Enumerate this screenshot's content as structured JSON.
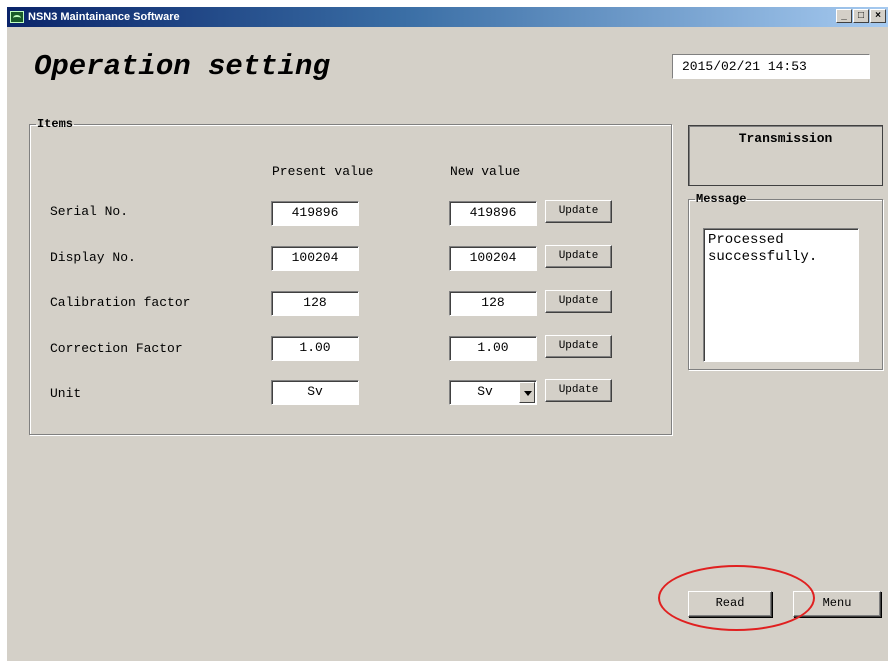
{
  "window": {
    "title": "NSN3 Maintainance Software",
    "minimize": "_",
    "maximize": "□",
    "close": "×"
  },
  "page": {
    "heading": "Operation setting",
    "datetime": "2015/02/21 14:53"
  },
  "items": {
    "legend": "Items",
    "present_header": "Present value",
    "new_header": "New value",
    "rows": [
      {
        "label": "Serial No.",
        "present": "419896",
        "new": "419896",
        "button": "Update"
      },
      {
        "label": "Display No.",
        "present": "100204",
        "new": "100204",
        "button": "Update"
      },
      {
        "label": "Calibration factor",
        "present": "128",
        "new": "128",
        "button": "Update"
      },
      {
        "label": "Correction Factor",
        "present": "1.00",
        "new": "1.00",
        "button": "Update"
      },
      {
        "label": "Unit",
        "present": "Sv",
        "new": "Sv",
        "button": "Update"
      }
    ]
  },
  "transmission": {
    "label": "Transmission"
  },
  "message": {
    "legend": "Message",
    "text": "Processed\nsuccessfully."
  },
  "footer": {
    "read_label": "Read",
    "menu_label": "Menu"
  },
  "colors": {
    "window_bg": "#d4d0c8",
    "title_start": "#0a246a",
    "annotation_circle": "#e02020"
  }
}
